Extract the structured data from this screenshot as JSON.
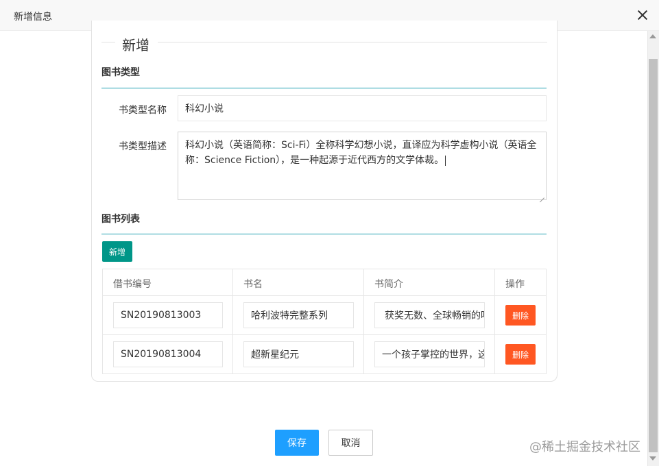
{
  "dialog": {
    "title": "新增信息"
  },
  "fieldset": {
    "legend": "新增"
  },
  "book_type": {
    "section_title": "图书类型",
    "name_label": "书类型名称",
    "name_value": "科幻小说",
    "desc_label": "书类型描述",
    "desc_value": "科幻小说（英语简称：Sci-Fi）全称科学幻想小说，直译应为科学虚构小说（英语全称：Science Fiction），是一种起源于近代西方的文学体裁。"
  },
  "book_list": {
    "section_title": "图书列表",
    "add_label": "新增",
    "columns": [
      "借书编号",
      "书名",
      "书简介",
      "操作"
    ],
    "rows": [
      {
        "id": "SN20190813003",
        "name": "哈利波特完整系列",
        "intro": "获奖无数、全球畅销的哈利",
        "action": "删除"
      },
      {
        "id": "SN20190813004",
        "name": "超新星纪元",
        "intro": "一个孩子掌控的世界，这",
        "action": "删除"
      }
    ]
  },
  "footer": {
    "save_label": "保存",
    "cancel_label": "取消"
  },
  "watermark": "@稀土掘金技术社区",
  "colors": {
    "teal": "#009688",
    "danger": "#ff5722",
    "primary": "#1e9fff",
    "section_line": "#1e9fb0"
  }
}
